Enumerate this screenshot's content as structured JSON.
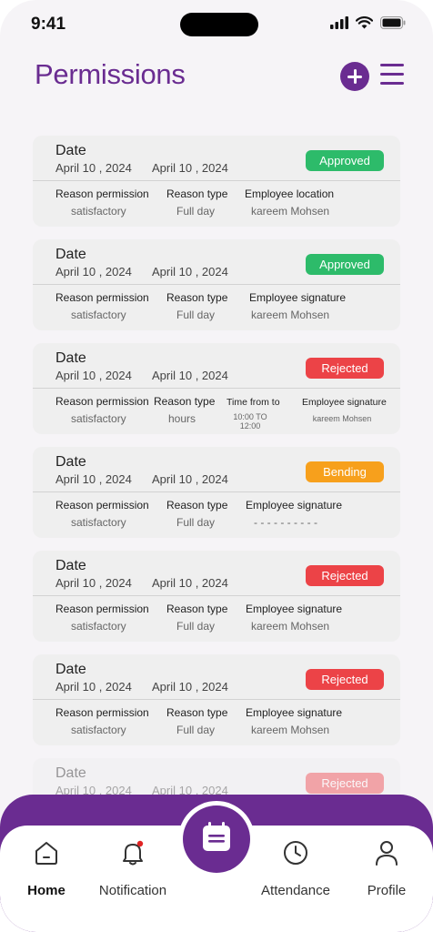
{
  "status_bar": {
    "time": "9:41"
  },
  "header": {
    "title": "Permissions",
    "add_icon": "plus-circle-icon",
    "menu_icon": "hamburger-icon"
  },
  "colors": {
    "accent": "#6a2c91",
    "approved": "#2dbb6a",
    "rejected": "#ec4347",
    "pending": "#f7a01c"
  },
  "cards": [
    {
      "date_label": "Date",
      "date_from": "April 10 , 2024",
      "date_to": "April 10 , 2024",
      "status": "Approved",
      "reason_label": "Reason permission",
      "reason_value": "satisfactory",
      "type_label": "Reason type",
      "type_value": "Full day",
      "extra_label": "Employee location",
      "extra_value": "kareem Mohsen"
    },
    {
      "date_label": "Date",
      "date_from": "April 10 , 2024",
      "date_to": "April 10 , 2024",
      "status": "Approved",
      "reason_label": "Reason permission",
      "reason_value": "satisfactory",
      "type_label": "Reason type",
      "type_value": "Full day",
      "extra_label": "Employee signature",
      "extra_value": "kareem Mohsen"
    },
    {
      "date_label": "Date",
      "date_from": "April 10 , 2024",
      "date_to": "April 10 , 2024",
      "status": "Rejected",
      "reason_label": "Reason permission",
      "reason_value": "satisfactory",
      "type_label": "Reason type",
      "type_value": "hours",
      "time_label": "Time from to",
      "time_from": "10:00 TO",
      "time_to": "12:00",
      "extra_label": "Employee signature",
      "extra_value": "kareem Mohsen"
    },
    {
      "date_label": "Date",
      "date_from": "April 10 , 2024",
      "date_to": "April 10 , 2024",
      "status": "Bending",
      "reason_label": "Reason permission",
      "reason_value": "satisfactory",
      "type_label": "Reason type",
      "type_value": "Full day",
      "extra_label": "Employee signature",
      "extra_value": "- - - - - - - - - -"
    },
    {
      "date_label": "Date",
      "date_from": "April 10 , 2024",
      "date_to": "April 10 , 2024",
      "status": "Rejected",
      "reason_label": "Reason permission",
      "reason_value": "satisfactory",
      "type_label": "Reason type",
      "type_value": "Full day",
      "extra_label": "Employee signature",
      "extra_value": "kareem Mohsen"
    },
    {
      "date_label": "Date",
      "date_from": "April 10 , 2024",
      "date_to": "April 10 , 2024",
      "status": "Rejected",
      "reason_label": "Reason permission",
      "reason_value": "satisfactory",
      "type_label": "Reason type",
      "type_value": "Full day",
      "extra_label": "Employee signature",
      "extra_value": "kareem Mohsen"
    },
    {
      "date_label": "Date",
      "date_from": "April 10 , 2024",
      "date_to": "April 10 , 2024",
      "status": "Rejected"
    }
  ],
  "nav": {
    "home": {
      "label": "Home",
      "icon": "home-icon"
    },
    "notification": {
      "label": "Notification",
      "icon": "bell-icon"
    },
    "center": {
      "icon": "calendar-list-icon"
    },
    "attendance": {
      "label": "Attendance",
      "icon": "clock-icon"
    },
    "profile": {
      "label": "Profile",
      "icon": "user-icon"
    }
  }
}
